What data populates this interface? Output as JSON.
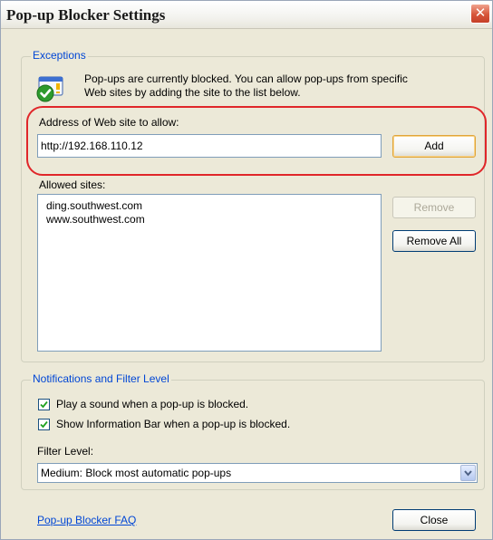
{
  "window": {
    "title": "Pop-up Blocker Settings"
  },
  "exceptions": {
    "legend": "Exceptions",
    "info_line1": "Pop-ups are currently blocked.  You can allow pop-ups from specific",
    "info_line2": "Web sites by adding the site to the list below.",
    "address_label": "Address of Web site to allow:",
    "address_value": "http://192.168.110.12",
    "add_label": "Add",
    "allowed_label": "Allowed sites:",
    "allowed_sites": [
      "ding.southwest.com",
      "www.southwest.com"
    ],
    "remove_label": "Remove",
    "remove_all_label": "Remove All"
  },
  "notifications": {
    "legend": "Notifications and Filter Level",
    "play_sound_label": "Play a sound when a pop-up is blocked.",
    "play_sound_checked": true,
    "info_bar_label": "Show Information Bar when a pop-up is blocked.",
    "info_bar_checked": true,
    "filter_label": "Filter Level:",
    "filter_value": "Medium: Block most automatic pop-ups"
  },
  "footer": {
    "faq_link": "Pop-up Blocker FAQ",
    "close_label": "Close"
  },
  "icons": {
    "close": "close-x-icon",
    "info": "shield-check-icon",
    "checkbox": "checkmark-icon",
    "dropdown": "chevron-down-icon"
  },
  "colors": {
    "accent_blue": "#0046d5",
    "highlight_red": "#e0262a",
    "dialog_bg": "#ece9d8"
  }
}
